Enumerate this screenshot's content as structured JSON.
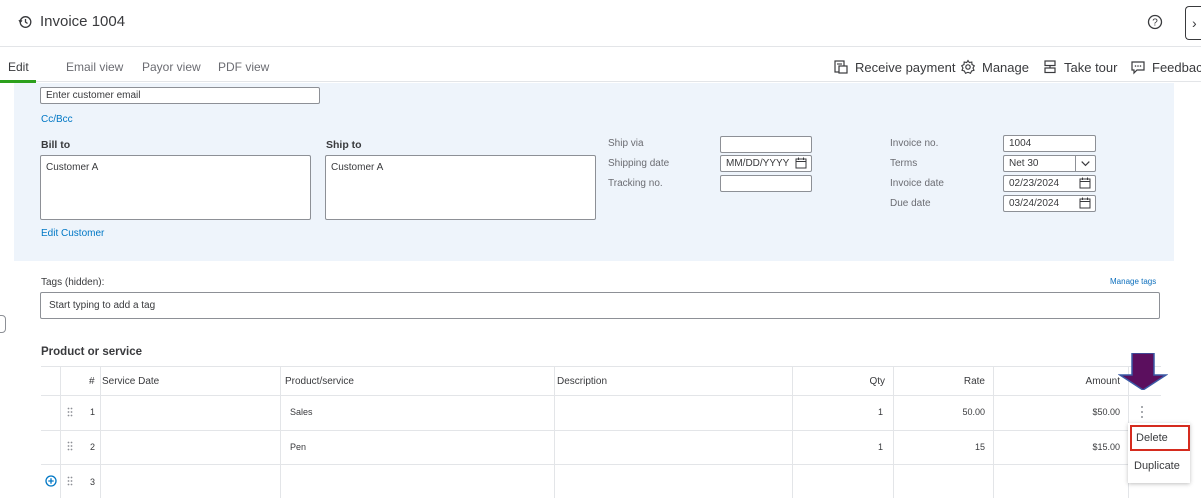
{
  "header": {
    "title": "Invoice 1004",
    "close_glyph": "›"
  },
  "tabs": [
    {
      "label": "Edit",
      "active": true
    },
    {
      "label": "Email view"
    },
    {
      "label": "Payor view"
    },
    {
      "label": "PDF view"
    }
  ],
  "actions": {
    "receive_payment": "Receive payment",
    "manage": "Manage",
    "take_tour": "Take tour",
    "feedback": "Feedback"
  },
  "customer": {
    "email_placeholder": "Enter customer email",
    "cc_bcc": "Cc/Bcc",
    "bill_to_label": "Bill to",
    "bill_to_value": "Customer A",
    "ship_to_label": "Ship to",
    "ship_to_value": "Customer A",
    "edit_customer": "Edit Customer"
  },
  "shipping": {
    "ship_via_label": "Ship via",
    "ship_via_value": "",
    "shipping_date_label": "Shipping date",
    "shipping_date_placeholder": "MM/DD/YYYY",
    "tracking_label": "Tracking no.",
    "tracking_value": ""
  },
  "invoice_meta": {
    "invoice_no_label": "Invoice no.",
    "invoice_no_value": "1004",
    "terms_label": "Terms",
    "terms_value": "Net 30",
    "invoice_date_label": "Invoice date",
    "invoice_date_value": "02/23/2024",
    "due_date_label": "Due date",
    "due_date_value": "03/24/2024"
  },
  "tags": {
    "label": "Tags (hidden):",
    "manage_link": "Manage tags",
    "placeholder": "Start typing to add a tag"
  },
  "table": {
    "section_title": "Product or service",
    "headers": {
      "num": "#",
      "service_date": "Service Date",
      "product": "Product/service",
      "description": "Description",
      "qty": "Qty",
      "rate": "Rate",
      "amount": "Amount"
    },
    "rows": [
      {
        "num": "1",
        "service_date": "",
        "product": "Sales",
        "description": "",
        "qty": "1",
        "rate": "50.00",
        "amount": "$50.00"
      },
      {
        "num": "2",
        "service_date": "",
        "product": "Pen",
        "description": "",
        "qty": "1",
        "rate": "15",
        "amount": "$15.00"
      },
      {
        "num": "3",
        "service_date": "",
        "product": "",
        "description": "",
        "qty": "",
        "rate": "",
        "amount": ""
      }
    ]
  },
  "row_menu": {
    "delete": "Delete",
    "duplicate": "Duplicate"
  },
  "colors": {
    "accent_green": "#2ca01c",
    "link_blue": "#0077c5",
    "panel_bg": "#eef4fb",
    "highlight_red": "#d52b1e",
    "annotation_arrow": "#5b0f5e"
  },
  "icons": [
    "history-icon",
    "help-icon",
    "receipt-icon",
    "gear-icon",
    "tour-icon",
    "feedback-icon",
    "calendar-icon",
    "chevron-down-icon",
    "drag-handle-icon",
    "kebab-menu-icon",
    "add-line-icon"
  ]
}
